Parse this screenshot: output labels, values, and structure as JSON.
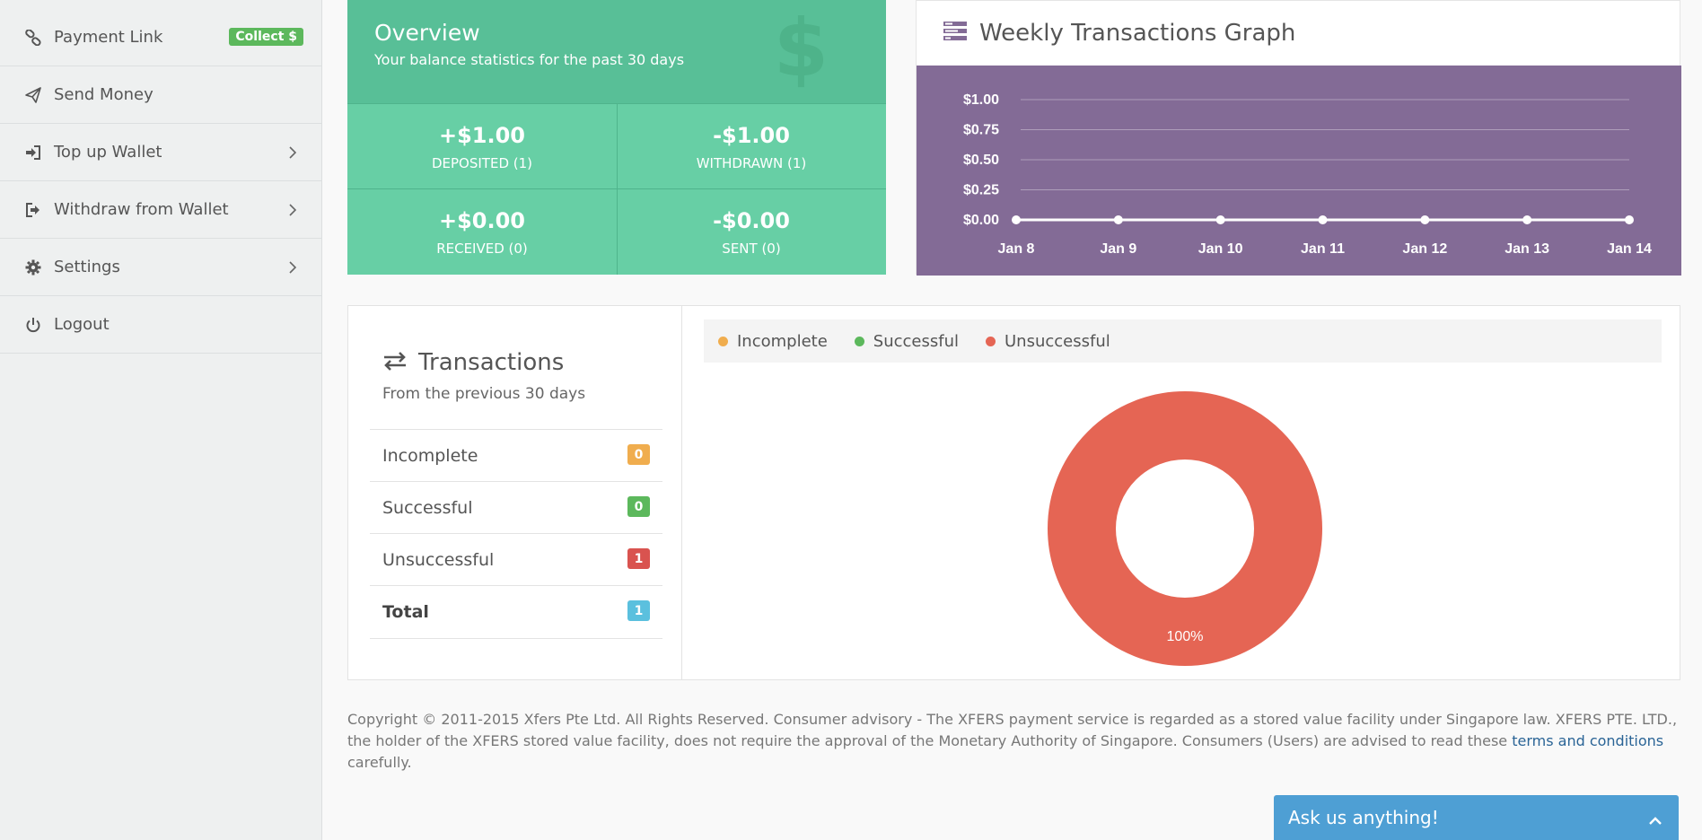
{
  "sidebar": {
    "items": [
      {
        "label": "Payment Link",
        "icon": "link-icon",
        "badge": "Collect $"
      },
      {
        "label": "Send Money",
        "icon": "paper-plane-icon"
      },
      {
        "label": "Top up Wallet",
        "icon": "sign-in-icon",
        "chevron": true
      },
      {
        "label": "Withdraw from Wallet",
        "icon": "sign-out-icon",
        "chevron": true
      },
      {
        "label": "Settings",
        "icon": "gear-icon",
        "chevron": true
      },
      {
        "label": "Logout",
        "icon": "power-icon"
      }
    ]
  },
  "overview": {
    "title": "Overview",
    "subtitle": "Your balance statistics for the past 30 days",
    "stats": [
      {
        "value": "+$1.00",
        "label": "DEPOSITED (1)"
      },
      {
        "value": "-$1.00",
        "label": "WITHDRAWN (1)"
      },
      {
        "value": "+$0.00",
        "label": "RECEIVED (0)"
      },
      {
        "value": "-$0.00",
        "label": "SENT (0)"
      }
    ]
  },
  "weekly": {
    "title": "Weekly Transactions Graph"
  },
  "chart_data": [
    {
      "type": "line",
      "categories": [
        "Jan 8",
        "Jan 9",
        "Jan 10",
        "Jan 11",
        "Jan 12",
        "Jan 13",
        "Jan 14"
      ],
      "values": [
        0,
        0,
        0,
        0,
        0,
        0,
        0
      ],
      "yticks": [
        "$1.00",
        "$0.75",
        "$0.50",
        "$0.25",
        "$0.00"
      ],
      "ylim": [
        0,
        1
      ],
      "grid": true
    },
    {
      "type": "pie",
      "categories": [
        "Incomplete",
        "Successful",
        "Unsuccessful"
      ],
      "values": [
        0,
        0,
        1
      ],
      "colors": [
        "#f0ad4e",
        "#5cb85c",
        "#e56554"
      ],
      "data_label": "100%"
    }
  ],
  "transactions": {
    "title": "Transactions",
    "subtitle": "From the previous 30 days",
    "rows": [
      {
        "label": "Incomplete",
        "count": "0",
        "color": "#f0ad4e"
      },
      {
        "label": "Successful",
        "count": "0",
        "color": "#5cb85c"
      },
      {
        "label": "Unsuccessful",
        "count": "1",
        "color": "#d9534f"
      },
      {
        "label": "Total",
        "count": "1",
        "color": "#5bc0de"
      }
    ],
    "legend": [
      "Incomplete",
      "Successful",
      "Unsuccessful"
    ]
  },
  "footer": {
    "text": "Copyright © 2011-2015 Xfers Pte Ltd. All Rights Reserved. Consumer advisory - The XFERS payment service is regarded as a stored value facility under Singapore law. XFERS PTE. LTD., the holder of the XFERS stored value facility, does not require the approval of the Monetary Authority of Singapore. Consumers (Users) are advised to read these",
    "link": "terms and conditions",
    "tail": "carefully."
  },
  "chat": {
    "label": "Ask us anything!"
  }
}
